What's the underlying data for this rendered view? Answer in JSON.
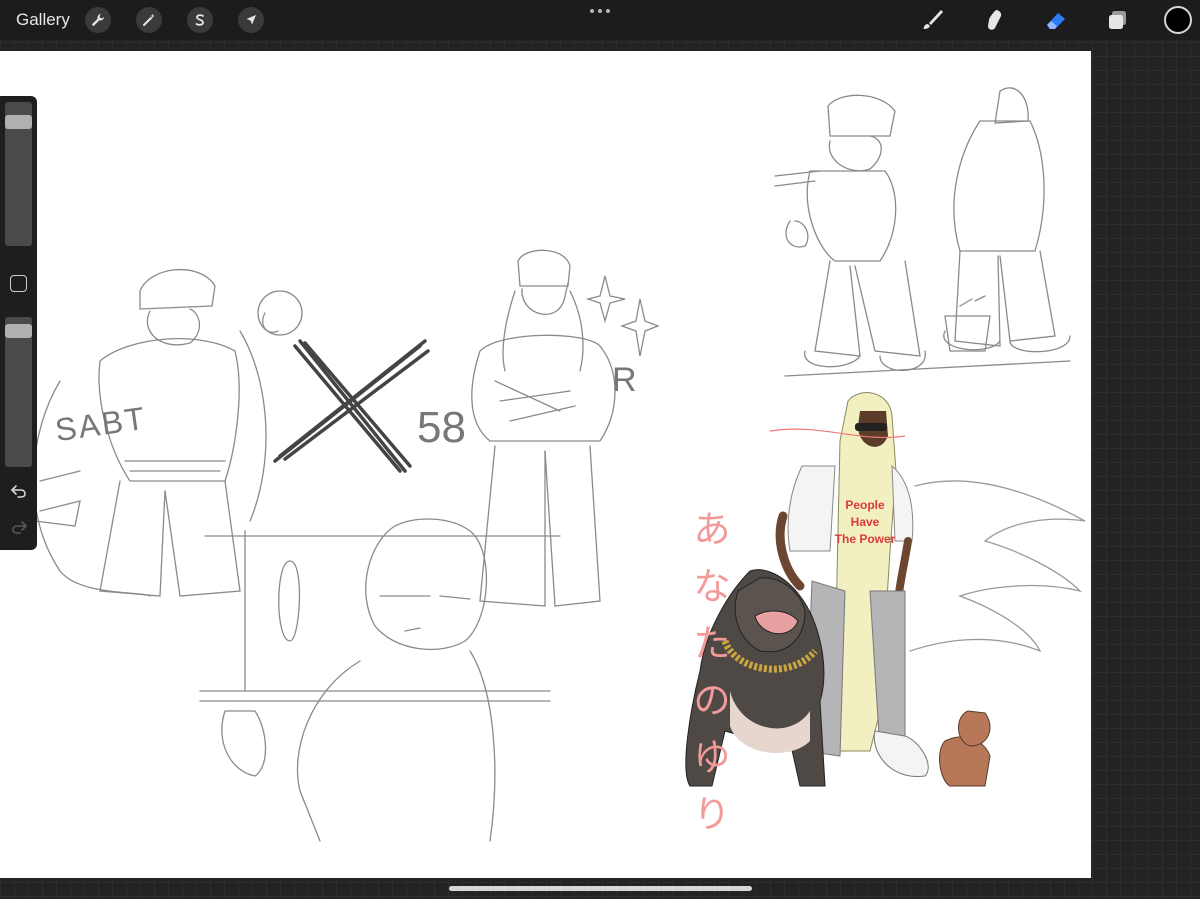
{
  "topbar": {
    "gallery_label": "Gallery",
    "left_tools": [
      {
        "name": "wrench-icon"
      },
      {
        "name": "magic-wand-icon"
      },
      {
        "name": "selection-s-icon"
      },
      {
        "name": "arrow-cursor-icon"
      }
    ],
    "right_tools": [
      {
        "name": "brush-icon",
        "active": false
      },
      {
        "name": "smudge-icon",
        "active": false
      },
      {
        "name": "eraser-icon",
        "active": true
      },
      {
        "name": "layers-icon",
        "active": false
      }
    ],
    "current_color": "#000000",
    "accent_color": "#2f7bf5"
  },
  "sidebar": {
    "brush_size": 0.1,
    "opacity": 0.05
  },
  "canvas": {
    "japanese_text": [
      "あ",
      "な",
      "た",
      "の",
      "ゆ",
      "り"
    ],
    "shirt_lines": [
      "People",
      "Have",
      "The Power"
    ],
    "sketch_numbers": "58",
    "sketch_letters_left": "SABT",
    "sketch_letters_right": "R"
  }
}
